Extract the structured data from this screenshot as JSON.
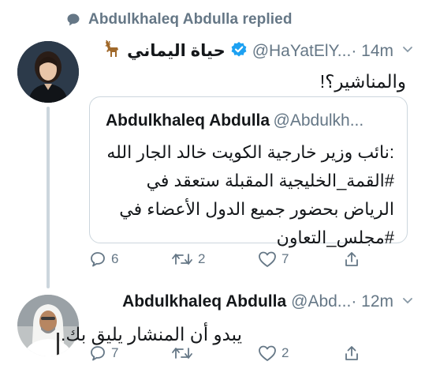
{
  "context": {
    "icon": "speech-bubble-icon",
    "text": "Abdulkhaleq Abdulla replied"
  },
  "tweet1": {
    "name": "حياة اليماني",
    "name_emoji": "deer-icon",
    "verified": true,
    "handle": "@HaYatElY...",
    "time": "· 14m",
    "text": "والمناشير؟!",
    "quote": {
      "name": "Abdulkhaleq Abdulla",
      "handle": "@Abdulkh...",
      "lines": [
        ":نائب وزير خارجية الكويت خالد الجار الله",
        "#القمة_الخليجية المقبلة ستعقد في",
        "الرياض بحضور جميع الدول الأعضاء في",
        "#مجلس_التعاون"
      ]
    },
    "actions": {
      "replies": "6",
      "retweets": "2",
      "likes": "7"
    }
  },
  "tweet2": {
    "name": "Abdulkhaleq Abdulla",
    "handle": "@Abd...",
    "time": "· 12m",
    "text": "يبدو أن المنشار يليق بك.",
    "actions": {
      "replies": "7",
      "retweets": "",
      "likes": "2"
    }
  },
  "colors": {
    "text_primary": "#14171a",
    "text_secondary": "#657786",
    "verified_blue": "#1da1f2",
    "border": "#ccd6dd"
  }
}
